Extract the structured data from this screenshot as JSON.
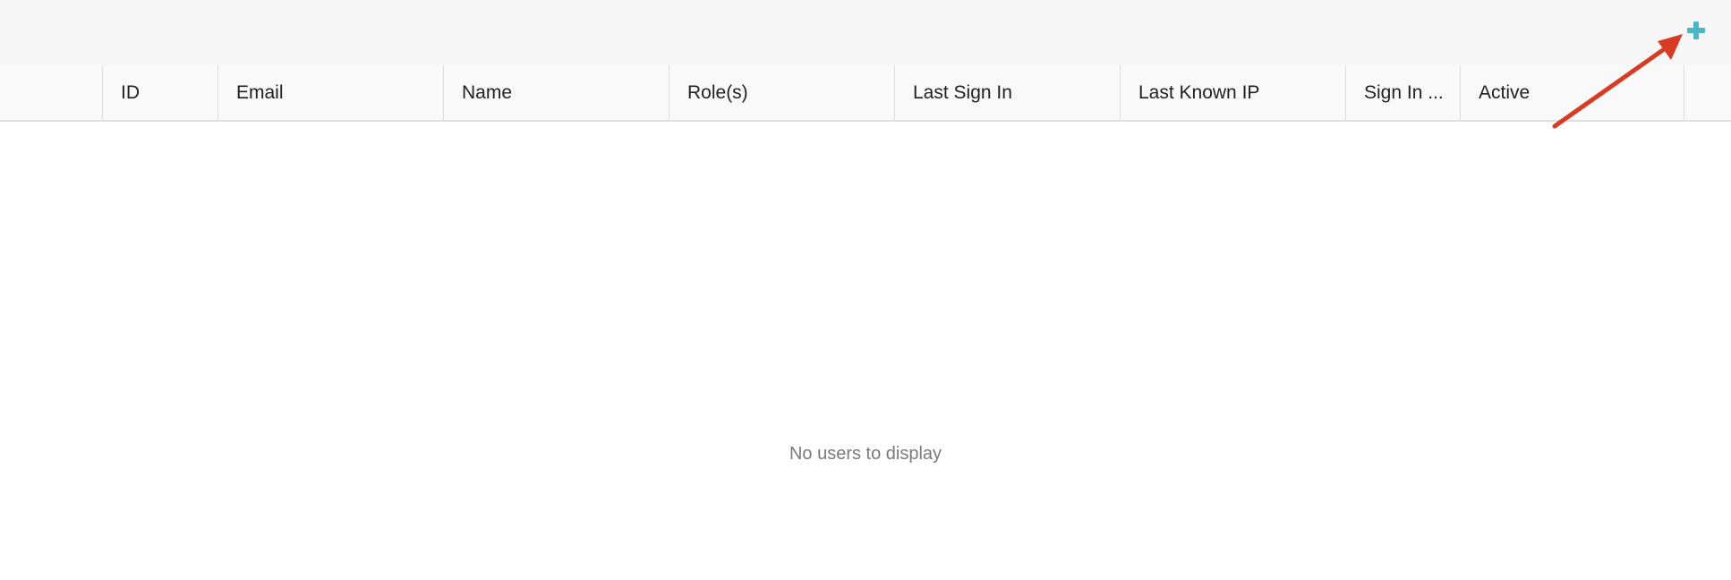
{
  "toolbar": {
    "add_icon": "plus-icon",
    "add_color": "#4db6c4"
  },
  "table": {
    "columns": [
      {
        "label": "ID"
      },
      {
        "label": "Email"
      },
      {
        "label": "Name"
      },
      {
        "label": "Role(s)"
      },
      {
        "label": "Last Sign In"
      },
      {
        "label": "Last Known IP"
      },
      {
        "label": "Sign In ..."
      },
      {
        "label": "Active"
      }
    ],
    "empty_message": "No users to display"
  },
  "annotation": {
    "arrow_color": "#d63b24"
  }
}
